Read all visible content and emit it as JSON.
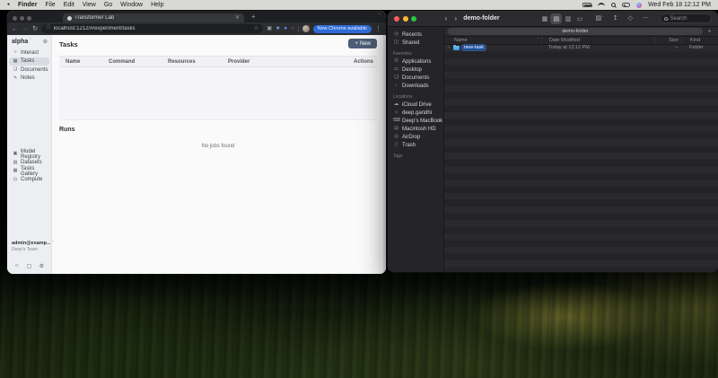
{
  "menu_bar": {
    "app_menu": "Finder",
    "menus": [
      "File",
      "Edit",
      "View",
      "Go",
      "Window",
      "Help"
    ],
    "clock": "Wed Feb 18 12:12 PM"
  },
  "browser": {
    "tab_title": "Transformer Lab",
    "url": "localhost:1212/#/experiment/tasks",
    "update_button": "New Chrome available"
  },
  "app": {
    "workspace": "alpha",
    "nav_primary": [
      {
        "label": "Interact",
        "icon": "code-icon"
      },
      {
        "label": "Tasks",
        "icon": "grid-icon"
      },
      {
        "label": "Documents",
        "icon": "document-icon"
      },
      {
        "label": "Notes",
        "icon": "note-icon"
      }
    ],
    "nav_secondary": [
      {
        "label": "Model Registry",
        "icon": "box-icon"
      },
      {
        "label": "Datasets",
        "icon": "dataset-icon"
      },
      {
        "label": "Tasks Gallery",
        "icon": "gallery-icon"
      },
      {
        "label": "Compute",
        "icon": "monitor-icon"
      }
    ],
    "account": {
      "email": "admin@examp...",
      "team": "Deep's Team"
    },
    "tasks_page": {
      "title": "Tasks",
      "new_button": "New",
      "columns": [
        "Name",
        "Command",
        "Resources",
        "Provider",
        "Actions"
      ],
      "runs_title": "Runs",
      "empty_message": "No jobs found"
    }
  },
  "finder": {
    "title": "demo-folder",
    "search_placeholder": "Search",
    "sidebar": {
      "top": [
        {
          "label": "Recents",
          "icon": "clock-icon"
        },
        {
          "label": "Shared",
          "icon": "shared-folder-icon"
        }
      ],
      "favorites_title": "Favorites",
      "favorites": [
        {
          "label": "Applications",
          "icon": "applications-icon"
        },
        {
          "label": "Desktop",
          "icon": "desktop-icon"
        },
        {
          "label": "Documents",
          "icon": "document-icon"
        },
        {
          "label": "Downloads",
          "icon": "download-icon"
        }
      ],
      "locations_title": "Locations",
      "locations": [
        {
          "label": "iCloud Drive",
          "icon": "cloud-icon"
        },
        {
          "label": "deep.gandhi",
          "icon": "home-icon"
        },
        {
          "label": "Deep's MacBook Air",
          "icon": "laptop-icon"
        },
        {
          "label": "Macintosh HD",
          "icon": "hard-drive-icon"
        },
        {
          "label": "AirDrop",
          "icon": "airdrop-icon"
        },
        {
          "label": "Trash",
          "icon": "trash-icon"
        }
      ],
      "tags_title": "Tags"
    },
    "tab_label": "demo-folder",
    "columns": [
      "Name",
      "Date Modified",
      "Size",
      "Kind"
    ],
    "rows": [
      {
        "name": "new-task",
        "date_modified": "Today at 12:12 PM",
        "size": "--",
        "kind": "Folder"
      }
    ]
  },
  "colors": {
    "accent_blue": "#2f6bd8",
    "folder_blue": "#3f93e4",
    "selection_blue": "#1c4f9e",
    "traffic_red": "#ff5f57",
    "traffic_yellow": "#febc2e",
    "traffic_green": "#28c840"
  }
}
